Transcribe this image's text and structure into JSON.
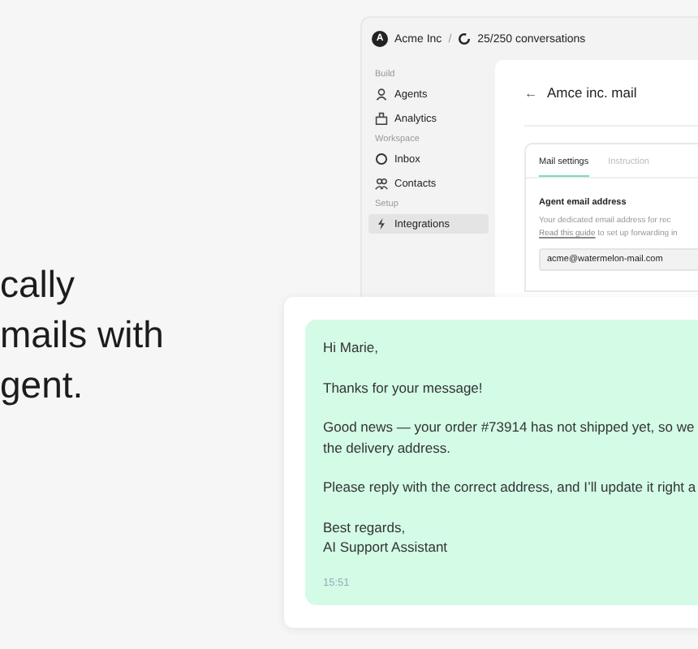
{
  "headline": [
    "cally",
    "mails with",
    "gent."
  ],
  "app": {
    "workspace": {
      "avatar": "A",
      "name": "Acme Inc",
      "separator": "/",
      "usage": "25/250 conversations"
    },
    "sidebar": [
      {
        "title": "Build",
        "items": [
          {
            "label": "Agents",
            "kind": "person",
            "selected": false
          },
          {
            "label": "Analytics",
            "kind": "building",
            "selected": false
          }
        ]
      },
      {
        "title": "Workspace",
        "items": [
          {
            "label": "Inbox",
            "kind": "ring",
            "selected": false
          },
          {
            "label": "Contacts",
            "kind": "people",
            "selected": false
          }
        ]
      },
      {
        "title": "Setup",
        "items": [
          {
            "label": "Integrations",
            "kind": "bolt",
            "selected": true
          }
        ]
      }
    ],
    "page": {
      "back": "←",
      "title": "Amce inc. mail",
      "tabs": [
        {
          "label": "Mail settings",
          "selected": true
        },
        {
          "label": "Instruction",
          "selected": false
        }
      ],
      "field_label": "Agent email address",
      "description": {
        "line": "Your dedicated email address for rec",
        "link": "Read this guide",
        "rest": "to set up forwarding in"
      },
      "email_value": "acme@watermelon-mail.com"
    }
  },
  "email": {
    "paragraphs": [
      [
        "Hi Marie,"
      ],
      [
        "Thanks for your message!"
      ],
      [
        "Good news — your order #73914 has not shipped yet, so we",
        "the delivery address."
      ],
      [
        "Please reply with the correct address, and I’ll update it right a"
      ],
      [
        "Best regards,",
        "AI Support Assistant"
      ]
    ],
    "time": "15:51"
  }
}
